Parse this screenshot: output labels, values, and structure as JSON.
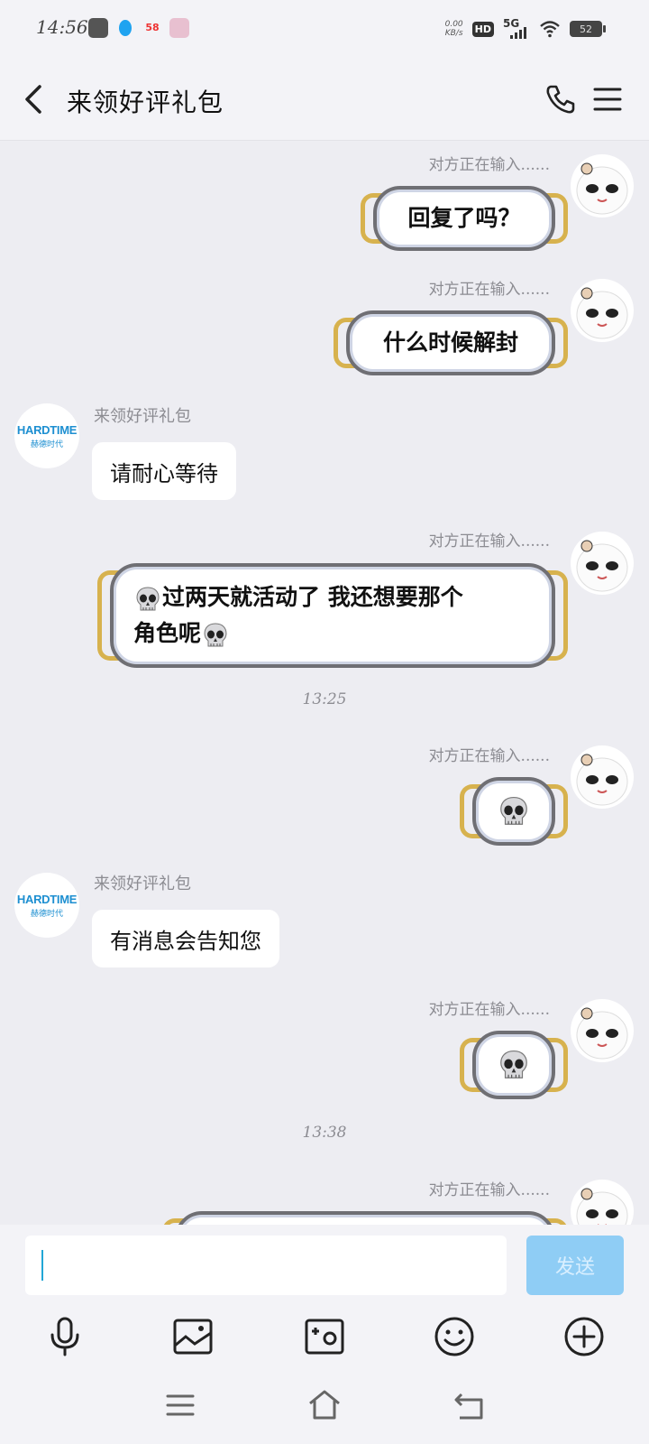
{
  "status_bar": {
    "time": "14:56",
    "net_speed_value": "0.00",
    "net_speed_unit": "KB/s",
    "hd": "HD",
    "signal": "5G",
    "battery": "52",
    "app_58": "58"
  },
  "header": {
    "title": "来领好评礼包"
  },
  "contact": {
    "name": "来领好评礼包",
    "logo_main": "HARDTIME",
    "logo_sub": "赫德时代"
  },
  "typing_indicator": "对方正在输入......",
  "messages": [
    {
      "side": "right",
      "text": "回复了吗？"
    },
    {
      "side": "right",
      "text": "什么时候解封"
    },
    {
      "side": "left",
      "text": "请耐心等待"
    },
    {
      "side": "right",
      "line1": "过两天就活动了 我还想要那个",
      "line2": "角色呢"
    },
    {
      "side": "right",
      "emoji": "skull"
    },
    {
      "side": "left",
      "text": "有消息会告知您"
    },
    {
      "side": "right",
      "emoji": "skull"
    }
  ],
  "timestamps": [
    "13:25",
    "13:38"
  ],
  "input": {
    "value": "",
    "send_label": "发送"
  },
  "colors": {
    "accent": "#8fcdf5",
    "mask_strap": "#d7b24e",
    "brand_logo": "#1d8fd1"
  },
  "icons": [
    "back-icon",
    "phone-icon",
    "menu-icon",
    "microphone-icon",
    "image-icon",
    "camera-icon",
    "emoji-icon",
    "plus-icon",
    "nav-menu-icon",
    "nav-home-icon",
    "nav-back-icon"
  ]
}
